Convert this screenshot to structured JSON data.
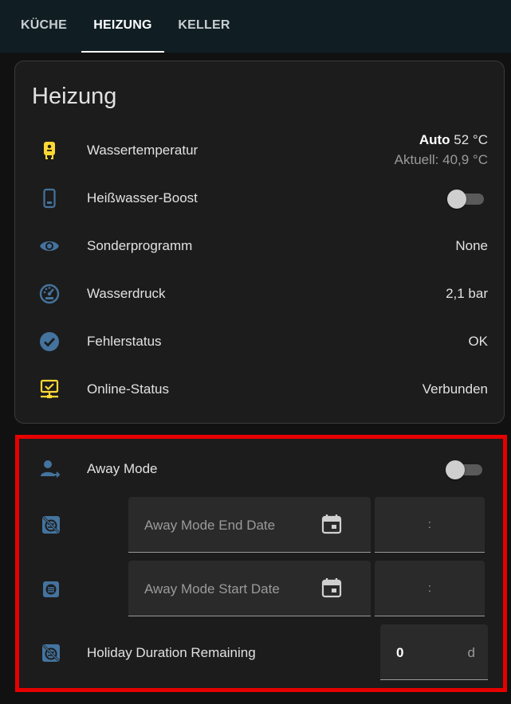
{
  "tabs": [
    {
      "label": "KÜCHE",
      "active": false
    },
    {
      "label": "HEIZUNG",
      "active": true
    },
    {
      "label": "KELLER",
      "active": false
    }
  ],
  "card": {
    "title": "Heizung",
    "rows": {
      "water_temp": {
        "label": "Wassertemperatur",
        "mode": "Auto",
        "target": "52 °C",
        "current": "Aktuell: 40,9 °C",
        "icon": "water-boiler-icon"
      },
      "boost": {
        "label": "Heißwasser-Boost",
        "state": "off",
        "icon": "phone-device-icon"
      },
      "program": {
        "label": "Sonderprogramm",
        "value": "None",
        "icon": "eye-icon"
      },
      "pressure": {
        "label": "Wasserdruck",
        "value": "2,1 bar",
        "icon": "gauge-icon"
      },
      "error": {
        "label": "Fehlerstatus",
        "value": "OK",
        "icon": "check-circle-icon"
      },
      "online": {
        "label": "Online-Status",
        "value": "Verbunden",
        "icon": "network-monitor-icon"
      }
    }
  },
  "away": {
    "mode": {
      "label": "Away Mode",
      "state": "off",
      "icon": "account-arrow-right-icon"
    },
    "end_date": {
      "placeholder": "Away Mode End Date",
      "time": ":",
      "icon": "calendar-off-icon"
    },
    "start_date": {
      "placeholder": "Away Mode Start Date",
      "time": ":",
      "icon": "calendar-list-icon"
    },
    "duration": {
      "label": "Holiday Duration Remaining",
      "value": "0",
      "unit": "d",
      "icon": "calendar-off-icon"
    }
  },
  "colors": {
    "accent_blue": "#44739e",
    "accent_yellow": "#fdd835",
    "highlight_red": "#e60000",
    "tabbar": "#101e24"
  }
}
